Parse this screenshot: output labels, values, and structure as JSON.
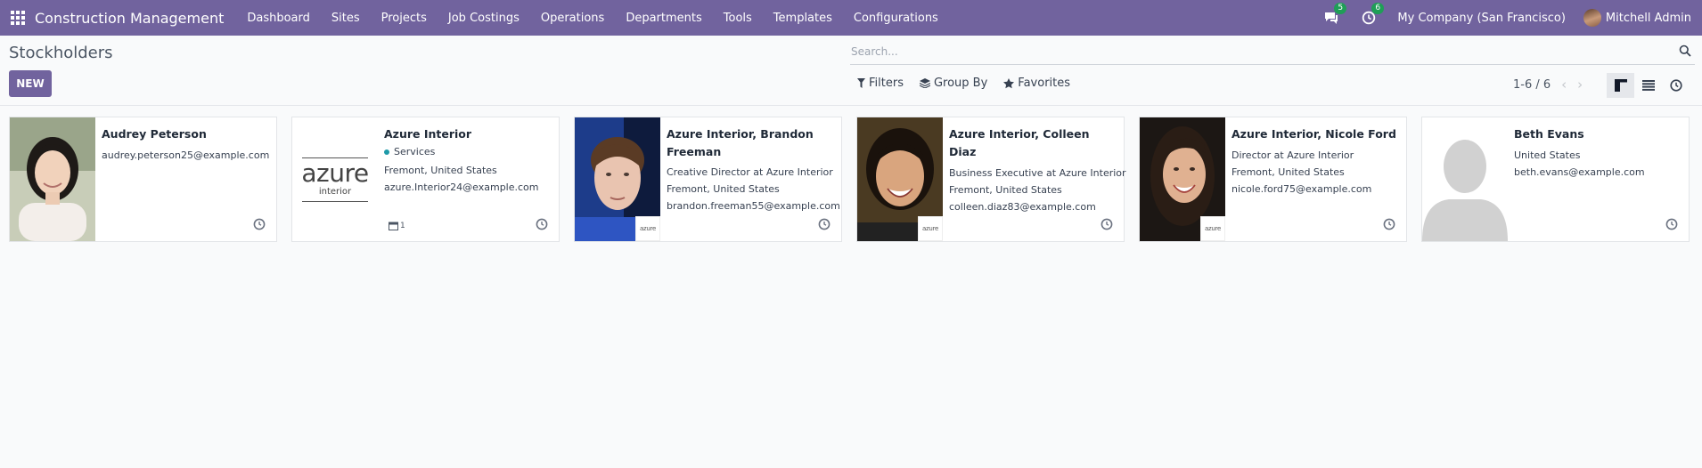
{
  "app": {
    "name": "Construction Management"
  },
  "menu": [
    "Dashboard",
    "Sites",
    "Projects",
    "Job Costings",
    "Operations",
    "Departments",
    "Tools",
    "Templates",
    "Configurations"
  ],
  "systray": {
    "messages_count": "5",
    "activities_count": "6",
    "company": "My Company (San Francisco)",
    "user": "Mitchell Admin"
  },
  "page": {
    "title": "Stockholders",
    "new_label": "NEW"
  },
  "search": {
    "placeholder": "Search..."
  },
  "filters": {
    "filters_label": "Filters",
    "groupby_label": "Group By",
    "favorites_label": "Favorites"
  },
  "pager": {
    "value": "1-6 / 6"
  },
  "logo_text": {
    "main": "azure",
    "sub": "interior"
  },
  "cards": [
    {
      "name": "Audrey Peterson",
      "lines": [
        "audrey.peterson25@example.com"
      ]
    },
    {
      "name": "Azure Interior",
      "tag": "Services",
      "lines": [
        "Fremont, United States",
        "azure.Interior24@example.com"
      ],
      "meetings": "1"
    },
    {
      "name": "Azure Interior, Brandon Freeman",
      "lines": [
        "Creative Director at Azure Interior",
        "Fremont, United States",
        "brandon.freeman55@example.com"
      ]
    },
    {
      "name": "Azure Interior, Colleen Diaz",
      "lines": [
        "Business Executive at Azure Interior",
        "Fremont, United States",
        "colleen.diaz83@example.com"
      ]
    },
    {
      "name": "Azure Interior, Nicole Ford",
      "lines": [
        "Director at Azure Interior",
        "Fremont, United States",
        "nicole.ford75@example.com"
      ]
    },
    {
      "name": "Beth Evans",
      "lines": [
        "United States",
        "beth.evans@example.com"
      ]
    }
  ]
}
